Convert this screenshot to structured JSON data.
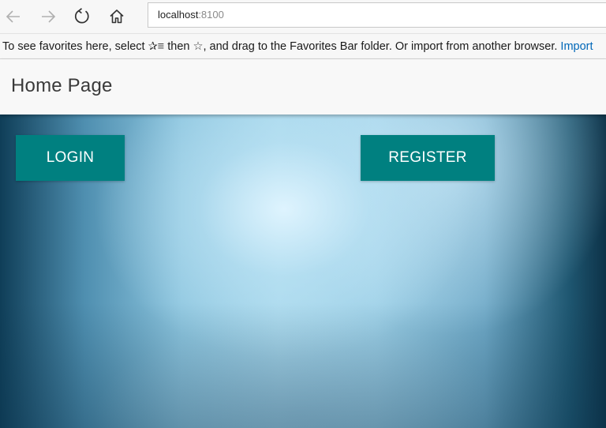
{
  "browser": {
    "address": {
      "host": "localhost",
      "port": ":8100"
    },
    "icons": {
      "back": "back-arrow-icon",
      "forward": "forward-arrow-icon",
      "refresh": "refresh-icon",
      "home": "home-icon"
    },
    "favorites_bar": {
      "text_before": "To see favorites here, select ",
      "glyph_hub": "✰≡",
      "text_middle": " then ",
      "glyph_star": "☆",
      "text_after": ", and drag to the Favorites Bar folder. Or import from another browser. ",
      "link": "Import"
    }
  },
  "app": {
    "header": {
      "title": "Home Page"
    },
    "buttons": {
      "login": "LOGIN",
      "register": "REGISTER"
    },
    "colors": {
      "button_bg": "#008080",
      "button_text": "#ffffff"
    }
  }
}
